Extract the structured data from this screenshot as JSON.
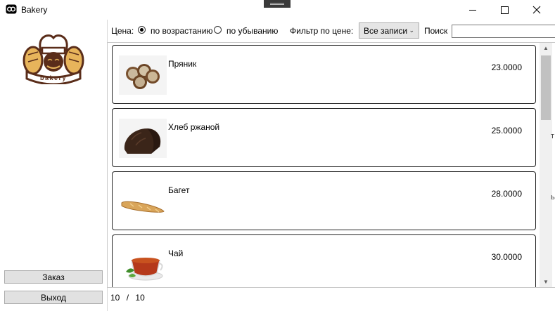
{
  "window": {
    "title": "Bakery",
    "icon": "app-icon"
  },
  "sidebar": {
    "logo_text": "bakery",
    "order_button": "Заказ",
    "exit_button": "Выход"
  },
  "filters": {
    "price_label": "Цена:",
    "sort_asc": "по возрастанию",
    "sort_desc": "по убыванию",
    "sort_selected": "asc",
    "price_filter_label": "Фильтр по цене:",
    "price_filter_value": "Все записи",
    "search_label": "Поиск",
    "search_value": ""
  },
  "products": [
    {
      "name": "Пряник",
      "price": "23.0000",
      "image": "gingerbread-image"
    },
    {
      "name": "Хлеб ржаной",
      "price": "25.0000",
      "image": "rye-bread-image"
    },
    {
      "name": "Багет",
      "price": "28.0000",
      "image": "baguette-image"
    },
    {
      "name": "Чай",
      "price": "30.0000",
      "image": "tea-cup-image"
    }
  ],
  "pager": {
    "shown": "10",
    "separator": "/",
    "total": "10"
  },
  "clipped_edge_text": [
    "т",
    "ь"
  ],
  "colors": {
    "accent": "#000000",
    "button_bg": "#e1e1e1",
    "logo_brown": "#5a2d1a",
    "logo_gold": "#e7b45b"
  }
}
